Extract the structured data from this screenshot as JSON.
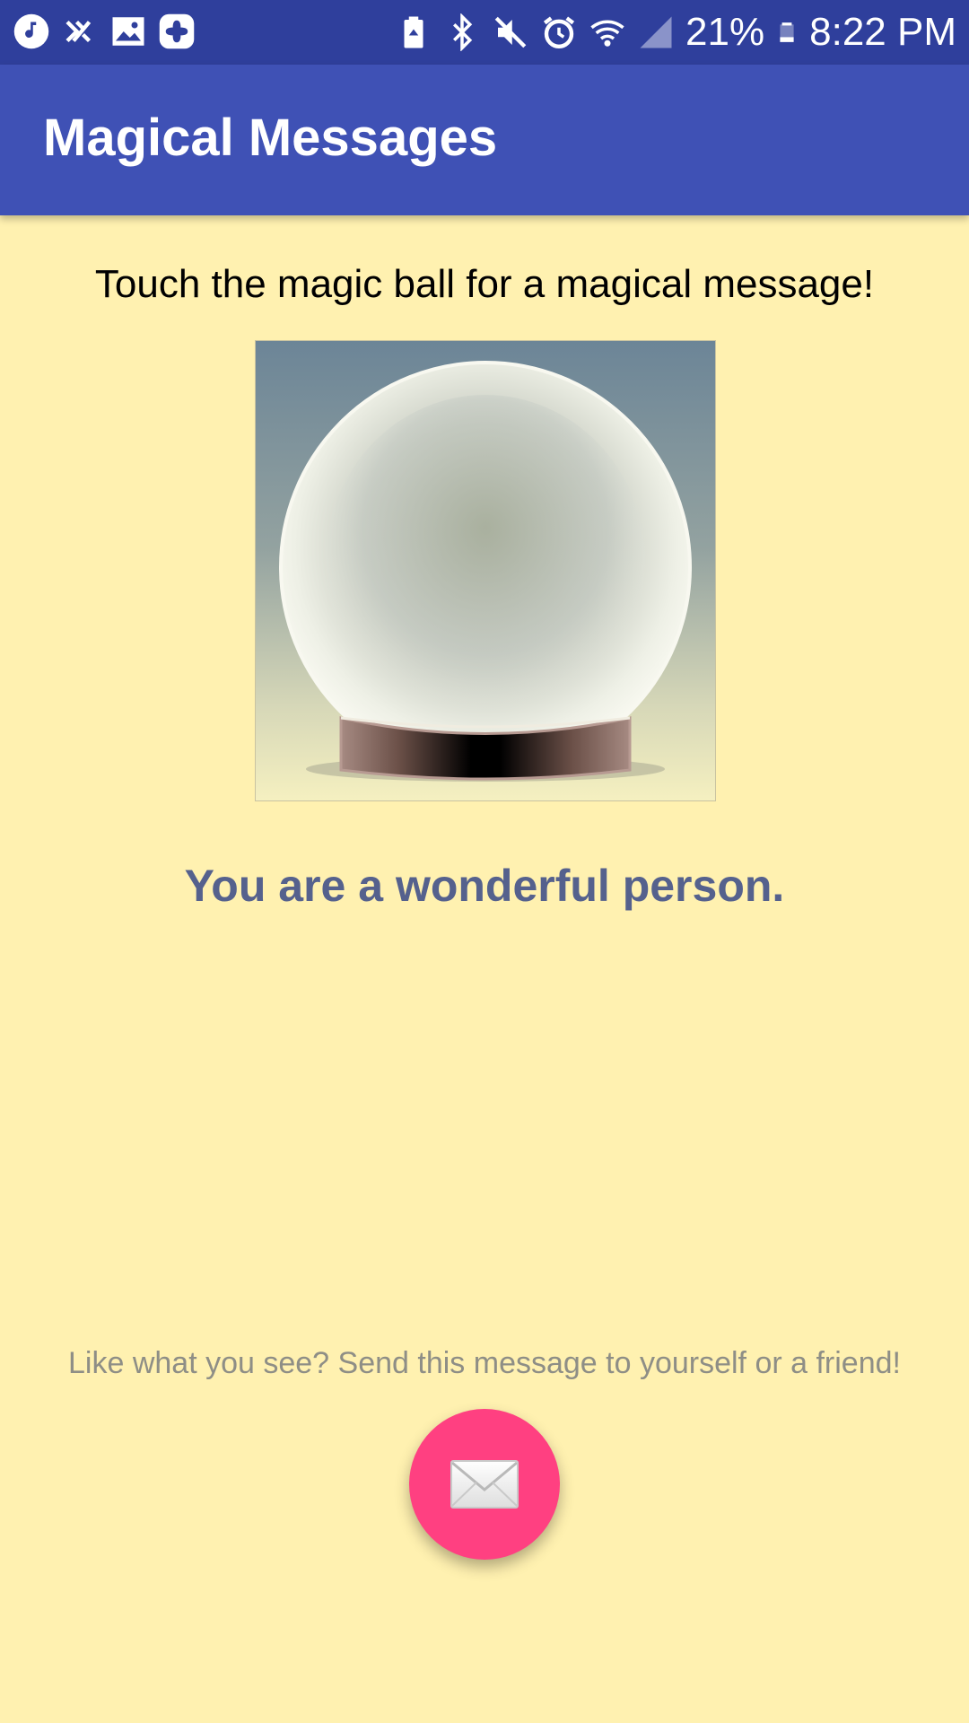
{
  "status_bar": {
    "battery_percent": "21%",
    "time": "8:22 PM",
    "left_icons": [
      "music-icon",
      "ship-icon",
      "image-icon",
      "plus-icon"
    ],
    "right_icons": [
      "battery-saver-icon",
      "bluetooth-icon",
      "mute-icon",
      "alarm-icon",
      "wifi-icon",
      "signal-icon",
      "battery-icon"
    ]
  },
  "app_bar": {
    "title": "Magical Messages"
  },
  "main": {
    "instruction": "Touch the magic ball for a magical message!",
    "magic_message": "You are a wonderful person.",
    "share_hint": "Like what you see? Send this message to yourself or a friend!"
  },
  "colors": {
    "status_bar": "#2f3f9c",
    "app_bar": "#3f51b5",
    "background": "#fff1b0",
    "message_text": "#55618d",
    "fab": "#ff4081"
  },
  "fab": {
    "icon": "envelope-icon"
  }
}
